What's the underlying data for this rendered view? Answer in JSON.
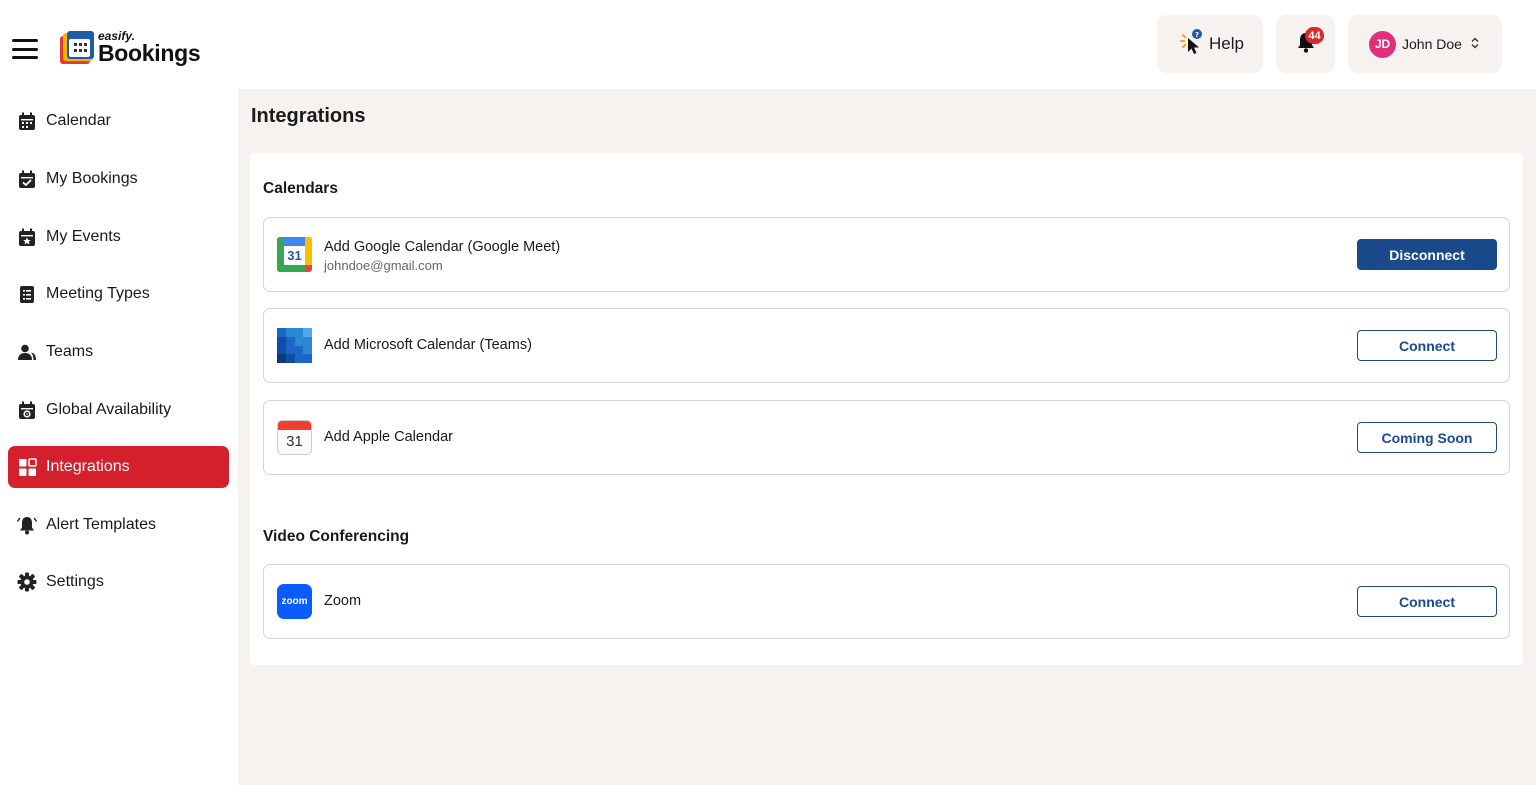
{
  "app": {
    "logo_small": "easify.",
    "logo_big": "Bookings"
  },
  "header": {
    "help_label": "Help",
    "notification_count": "44",
    "user": {
      "initials": "JD",
      "name": "John Doe"
    }
  },
  "sidebar": {
    "items": [
      {
        "label": "Calendar",
        "icon": "calendar-icon"
      },
      {
        "label": "My Bookings",
        "icon": "calendar-check-icon"
      },
      {
        "label": "My Events",
        "icon": "calendar-star-icon"
      },
      {
        "label": "Meeting Types",
        "icon": "list-icon"
      },
      {
        "label": "Teams",
        "icon": "users-icon"
      },
      {
        "label": "Global Availability",
        "icon": "calendar-gear-icon"
      },
      {
        "label": "Integrations",
        "icon": "grid-icon",
        "active": true
      },
      {
        "label": "Alert Templates",
        "icon": "bell-icon"
      },
      {
        "label": "Settings",
        "icon": "gear-icon"
      }
    ]
  },
  "main": {
    "title": "Integrations",
    "sections": {
      "calendars": {
        "title": "Calendars",
        "items": [
          {
            "name": "Add Google Calendar (Google Meet)",
            "sub": "johndoe@gmail.com",
            "button": "Disconnect"
          },
          {
            "name": "Add Microsoft Calendar (Teams)",
            "button": "Connect"
          },
          {
            "name": "Add Apple Calendar",
            "button": "Coming Soon",
            "logo_text": "31"
          }
        ],
        "google_logo_text": "31"
      },
      "video": {
        "title": "Video Conferencing",
        "items": [
          {
            "name": "Zoom",
            "button": "Connect",
            "logo_text": "zoom"
          }
        ]
      }
    }
  },
  "colors": {
    "accent_red": "#d41f2c",
    "primary_blue": "#1b4a8c",
    "main_bg": "#f6f2ef"
  }
}
